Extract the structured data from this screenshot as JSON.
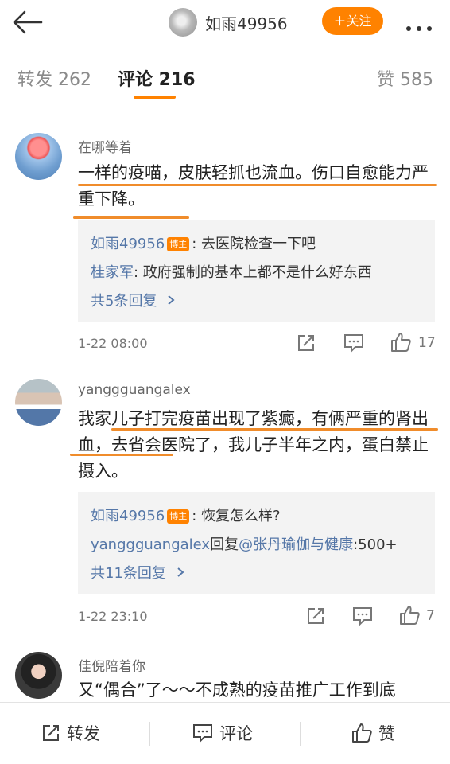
{
  "header": {
    "title": "如雨49956",
    "follow_label": "＋关注"
  },
  "tabs": [
    {
      "label": "转发 262",
      "active": false
    },
    {
      "label": "评论 216",
      "active": true
    },
    {
      "label": "赞 585",
      "active": false
    }
  ],
  "comments": [
    {
      "author": "在哪等着",
      "text": "一样的疫喵，皮肤轻抓也流血。伤口自愈能力严重下降。",
      "reply1_author": "如雨49956",
      "reply1_badge": "博主",
      "reply1_text": ": 去医院检查一下吧",
      "reply2_author": "桂家军",
      "reply2_text": ": 政府强制的基本上都不是什么好东西",
      "more_replies": "共5条回复",
      "time": "1-22 08:00",
      "likes": "17"
    },
    {
      "author": "yanggguangalex",
      "text": "我家儿子打完疫苗出现了紫癜，有俩严重的肾出血，去省会医院了，我儿子半年之内，蛋白禁止摄入。",
      "reply1_author": "如雨49956",
      "reply1_badge": "博主",
      "reply1_text": ": 恢复怎么样?",
      "reply2_author": "yanggguangalex",
      "reply2_mid": "回复",
      "reply2_mention": "@张丹瑜伽与健康",
      "reply2_text": ":500+",
      "more_replies": "共11条回复",
      "time": "1-22 23:10",
      "likes": "7"
    },
    {
      "author": "佳倪陪着你",
      "text": "又“偶合”了～～不成熟的疫苗推广工作到底"
    }
  ],
  "bottom_bar": {
    "repost": "转发",
    "comment": "评论",
    "like": "赞"
  },
  "colors": {
    "accent": "#ff8200",
    "link": "#5577a8",
    "underline": "#f08c2b"
  }
}
